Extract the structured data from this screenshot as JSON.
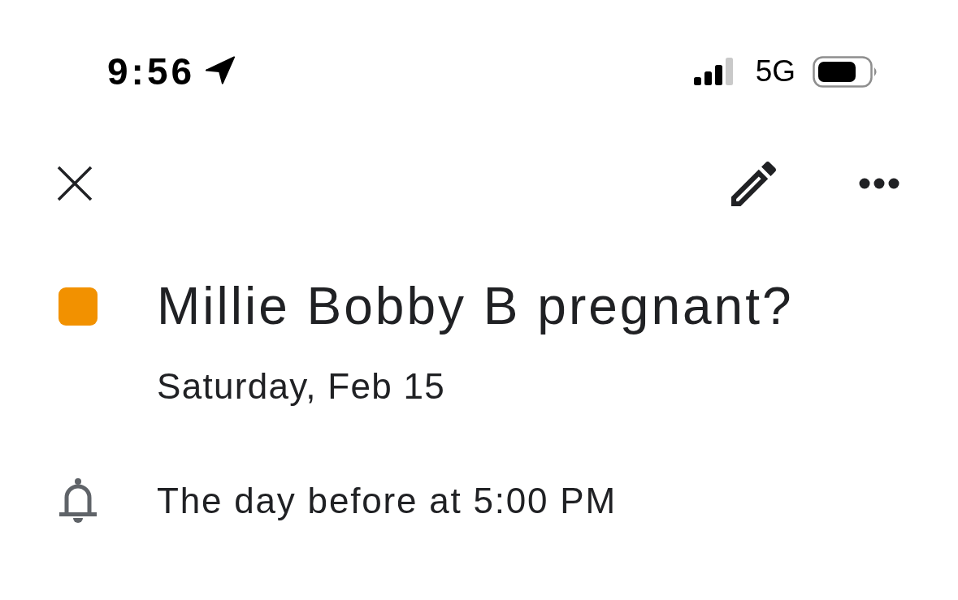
{
  "status_bar": {
    "time": "9:56",
    "network": "5G"
  },
  "event": {
    "title": "Millie Bobby B pregnant?",
    "color": "#f29100",
    "date": "Saturday, Feb 15"
  },
  "notification": {
    "text": "The day before at 5:00 PM"
  }
}
